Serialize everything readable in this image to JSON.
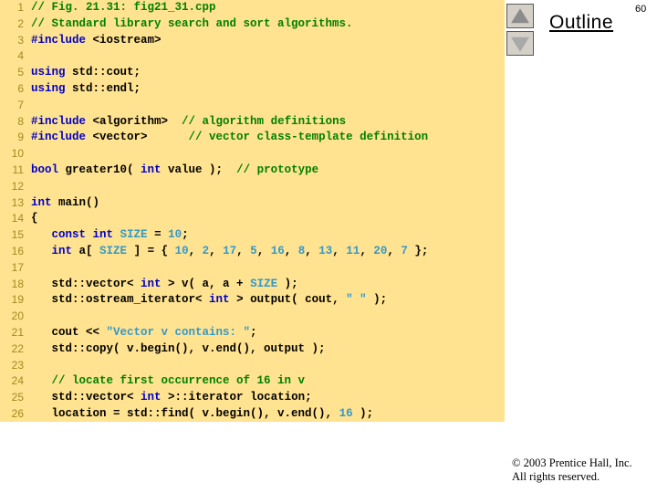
{
  "page_number": "60",
  "outline": {
    "title": "Outline"
  },
  "scroll": {
    "up_icon": "triangle-up-icon",
    "down_icon": "triangle-down-icon"
  },
  "footer": {
    "line1": "© 2003 Prentice Hall, Inc.",
    "line2": "All rights reserved."
  },
  "colors": {
    "panel_background": "#ffe390",
    "page_background": "#ffffff",
    "comment": "#008000",
    "keyword": "#0000c8",
    "literal": "#3399cc",
    "plain": "#000000",
    "line_number": "#a08a1e",
    "button_face": "#d4d0c8"
  },
  "code": {
    "language": "C++",
    "file": "fig21_31.cpp",
    "lines": [
      {
        "n": "1",
        "tokens": [
          {
            "t": "// Fig. 21.31: fig21_31.cpp",
            "c": "cmt"
          }
        ]
      },
      {
        "n": "2",
        "tokens": [
          {
            "t": "// Standard library search and sort algorithms.",
            "c": "cmt"
          }
        ]
      },
      {
        "n": "3",
        "tokens": [
          {
            "t": "#include",
            "c": "kw"
          },
          {
            "t": " <iostream>",
            "c": "pln"
          }
        ]
      },
      {
        "n": "4",
        "tokens": []
      },
      {
        "n": "5",
        "tokens": [
          {
            "t": "using",
            "c": "kw"
          },
          {
            "t": " std::cout;",
            "c": "pln"
          }
        ]
      },
      {
        "n": "6",
        "tokens": [
          {
            "t": "using",
            "c": "kw"
          },
          {
            "t": " std::endl;",
            "c": "pln"
          }
        ]
      },
      {
        "n": "7",
        "tokens": []
      },
      {
        "n": "8",
        "tokens": [
          {
            "t": "#include",
            "c": "kw"
          },
          {
            "t": " <algorithm>  ",
            "c": "pln"
          },
          {
            "t": "// algorithm definitions",
            "c": "cmt"
          }
        ]
      },
      {
        "n": "9",
        "tokens": [
          {
            "t": "#include",
            "c": "kw"
          },
          {
            "t": " <vector>      ",
            "c": "pln"
          },
          {
            "t": "// vector class-template definition",
            "c": "cmt"
          }
        ]
      },
      {
        "n": "10",
        "tokens": []
      },
      {
        "n": "11",
        "tokens": [
          {
            "t": "bool",
            "c": "kw"
          },
          {
            "t": " greater10( ",
            "c": "pln"
          },
          {
            "t": "int",
            "c": "kw"
          },
          {
            "t": " value );  ",
            "c": "pln"
          },
          {
            "t": "// prototype",
            "c": "cmt"
          }
        ]
      },
      {
        "n": "12",
        "tokens": []
      },
      {
        "n": "13",
        "tokens": [
          {
            "t": "int",
            "c": "kw"
          },
          {
            "t": " main()",
            "c": "pln"
          }
        ]
      },
      {
        "n": "14",
        "tokens": [
          {
            "t": "{",
            "c": "pln"
          }
        ]
      },
      {
        "n": "15",
        "tokens": [
          {
            "t": "   ",
            "c": "pln"
          },
          {
            "t": "const int",
            "c": "kw"
          },
          {
            "t": " ",
            "c": "pln"
          },
          {
            "t": "SIZE",
            "c": "lit"
          },
          {
            "t": " = ",
            "c": "pln"
          },
          {
            "t": "10",
            "c": "lit"
          },
          {
            "t": ";",
            "c": "pln"
          }
        ]
      },
      {
        "n": "16",
        "tokens": [
          {
            "t": "   ",
            "c": "pln"
          },
          {
            "t": "int",
            "c": "kw"
          },
          {
            "t": " a[ ",
            "c": "pln"
          },
          {
            "t": "SIZE",
            "c": "lit"
          },
          {
            "t": " ] = { ",
            "c": "pln"
          },
          {
            "t": "10",
            "c": "lit"
          },
          {
            "t": ", ",
            "c": "pln"
          },
          {
            "t": "2",
            "c": "lit"
          },
          {
            "t": ", ",
            "c": "pln"
          },
          {
            "t": "17",
            "c": "lit"
          },
          {
            "t": ", ",
            "c": "pln"
          },
          {
            "t": "5",
            "c": "lit"
          },
          {
            "t": ", ",
            "c": "pln"
          },
          {
            "t": "16",
            "c": "lit"
          },
          {
            "t": ", ",
            "c": "pln"
          },
          {
            "t": "8",
            "c": "lit"
          },
          {
            "t": ", ",
            "c": "pln"
          },
          {
            "t": "13",
            "c": "lit"
          },
          {
            "t": ", ",
            "c": "pln"
          },
          {
            "t": "11",
            "c": "lit"
          },
          {
            "t": ", ",
            "c": "pln"
          },
          {
            "t": "20",
            "c": "lit"
          },
          {
            "t": ", ",
            "c": "pln"
          },
          {
            "t": "7",
            "c": "lit"
          },
          {
            "t": " };",
            "c": "pln"
          }
        ]
      },
      {
        "n": "17",
        "tokens": []
      },
      {
        "n": "18",
        "tokens": [
          {
            "t": "   std::vector< ",
            "c": "pln"
          },
          {
            "t": "int",
            "c": "kw"
          },
          {
            "t": " > v( a, a + ",
            "c": "pln"
          },
          {
            "t": "SIZE",
            "c": "lit"
          },
          {
            "t": " );",
            "c": "pln"
          }
        ]
      },
      {
        "n": "19",
        "tokens": [
          {
            "t": "   std::ostream_iterator< ",
            "c": "pln"
          },
          {
            "t": "int",
            "c": "kw"
          },
          {
            "t": " > output( cout, ",
            "c": "pln"
          },
          {
            "t": "\" \"",
            "c": "lit"
          },
          {
            "t": " );",
            "c": "pln"
          }
        ]
      },
      {
        "n": "20",
        "tokens": []
      },
      {
        "n": "21",
        "tokens": [
          {
            "t": "   cout << ",
            "c": "pln"
          },
          {
            "t": "\"Vector v contains: \"",
            "c": "lit"
          },
          {
            "t": ";",
            "c": "pln"
          }
        ]
      },
      {
        "n": "22",
        "tokens": [
          {
            "t": "   std::copy( v.begin(), v.end(), output );",
            "c": "pln"
          }
        ]
      },
      {
        "n": "23",
        "tokens": []
      },
      {
        "n": "24",
        "tokens": [
          {
            "t": "   ",
            "c": "pln"
          },
          {
            "t": "// locate first occurrence of 16 in v",
            "c": "cmt"
          }
        ]
      },
      {
        "n": "25",
        "tokens": [
          {
            "t": "   std::vector< ",
            "c": "pln"
          },
          {
            "t": "int",
            "c": "kw"
          },
          {
            "t": " >::iterator location;",
            "c": "pln"
          }
        ]
      },
      {
        "n": "26",
        "tokens": [
          {
            "t": "   location = std::find( v.begin(), v.end(), ",
            "c": "pln"
          },
          {
            "t": "16",
            "c": "lit"
          },
          {
            "t": " );",
            "c": "pln"
          }
        ]
      }
    ]
  }
}
